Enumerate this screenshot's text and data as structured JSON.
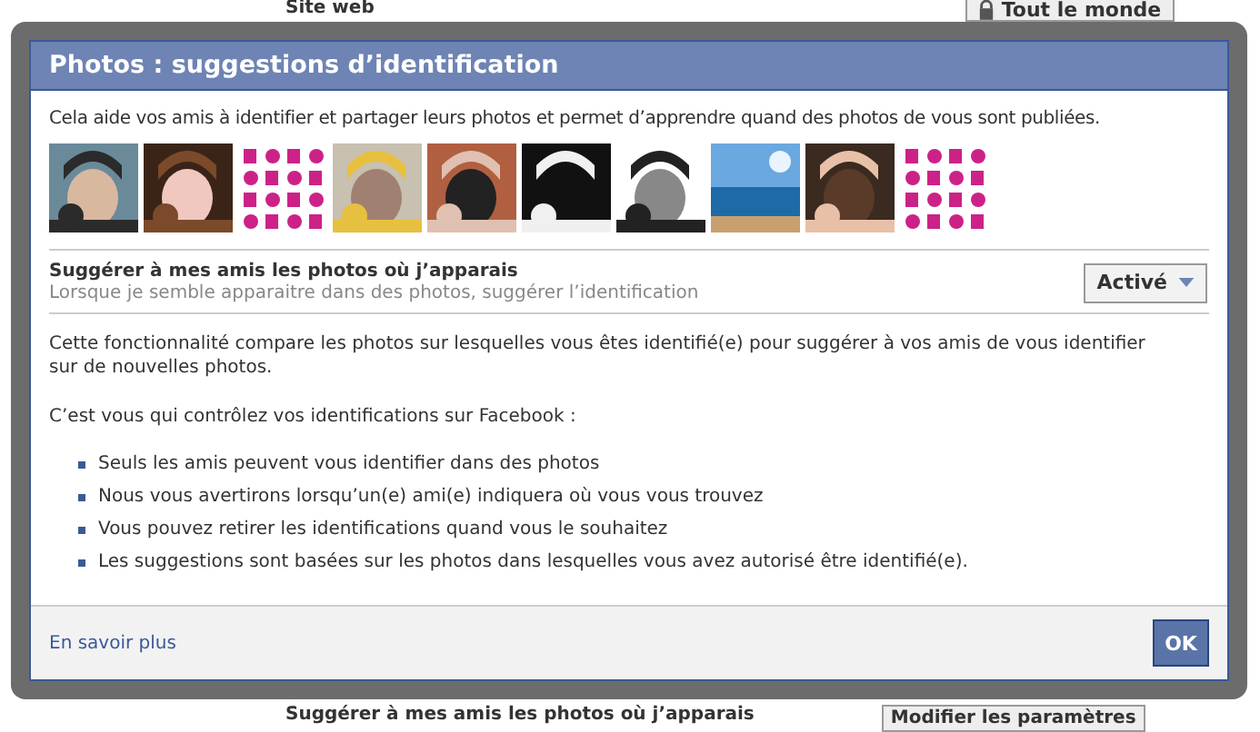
{
  "background_page": {
    "top_label": "Site web",
    "audience_button": "Tout le monde",
    "bottom_heading": "Suggérer à mes amis les photos où j’apparais",
    "settings_button": "Modifier les paramètres"
  },
  "dialog": {
    "title": "Photos : suggestions d’identification",
    "intro": "Cela aide vos amis à identifier et partager leurs photos et permet d’apprendre quand des photos de vous sont publiées.",
    "setting": {
      "title": "Suggérer à mes amis les photos où j’apparais",
      "description": "Lorsque je semble apparaitre dans des photos, suggérer l’identification",
      "value": "Activé"
    },
    "explanation": "Cette fonctionnalité compare les photos sur lesquelles vous êtes identifié(e) pour suggérer à vos amis de vous identifier sur de nouvelles photos.",
    "list_heading": "C’est vous qui contrôlez vos identifications sur Facebook :",
    "bullets": [
      "Seuls les amis peuvent vous identifier dans des photos",
      "Nous vous avertirons lorsqu’un(e) ami(e) indiquera où vous vous trouvez",
      "Vous pouvez retirer les identifications quand vous le souhaitez",
      "Les suggestions sont basées sur les photos dans lesquelles vous avez autorisé être identifié(e)."
    ],
    "footer_link": "En savoir plus",
    "ok_button": "OK"
  }
}
